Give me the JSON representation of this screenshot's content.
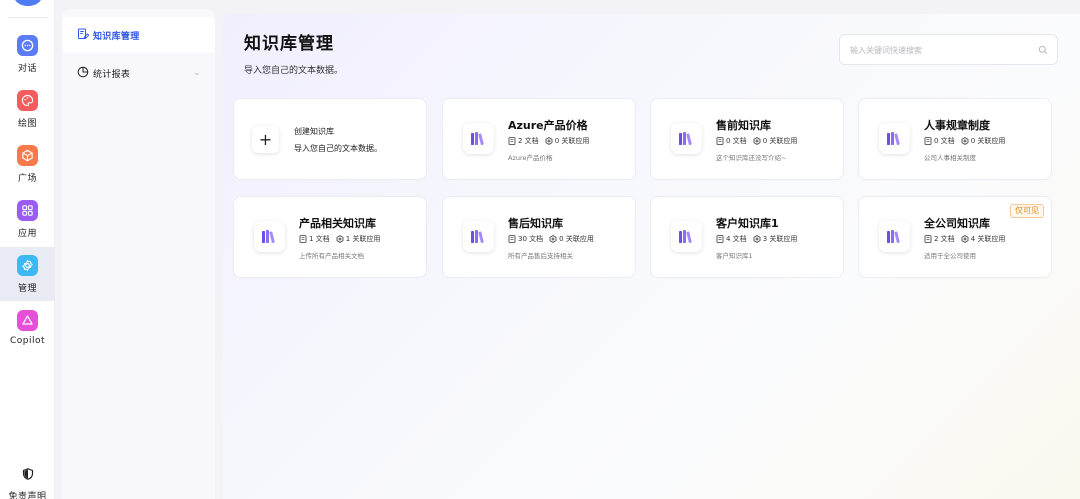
{
  "rail": {
    "items": [
      {
        "label": "对话",
        "icon": "chat-bubble-icon",
        "color": "#5b7cf6"
      },
      {
        "label": "绘图",
        "icon": "palette-icon",
        "color": "#f45d5d"
      },
      {
        "label": "广场",
        "icon": "cube-icon",
        "color": "#f87a4a"
      },
      {
        "label": "应用",
        "icon": "apps-grid-icon",
        "color": "#9a5cf3"
      },
      {
        "label": "管理",
        "icon": "gear-icon",
        "color": "#3cb8f2",
        "active": true
      },
      {
        "label": "Copilot",
        "icon": "copilot-triangle-icon",
        "color": "#e64fd8"
      }
    ],
    "disclaimer": {
      "label": "免责声明",
      "icon": "shield-icon"
    }
  },
  "submenu": {
    "items": [
      {
        "label": "知识库管理",
        "icon": "knowledge-edit-icon",
        "active": true
      },
      {
        "label": "统计报表",
        "icon": "pie-chart-icon",
        "expandable": true
      }
    ]
  },
  "main": {
    "title": "知识库管理",
    "subtitle": "导入您自己的文本数据。",
    "search_placeholder": "输入关键词快速搜索",
    "create_card": {
      "title": "创建知识库",
      "desc": "导入您自己的文本数据。"
    },
    "cards": [
      {
        "title": "Azure产品价格",
        "docs": "2 文档",
        "apps": "0 关联应用",
        "desc": "Azure产品价格"
      },
      {
        "title": "售前知识库",
        "docs": "0 文档",
        "apps": "0 关联应用",
        "desc": "这个知识库还没写介绍~"
      },
      {
        "title": "人事规章制度",
        "docs": "0 文档",
        "apps": "0 关联应用",
        "desc": "公司人事相关制度"
      },
      {
        "title": "产品相关知识库",
        "docs": "1 文档",
        "apps": "1 关联应用",
        "desc": "上传所有产品相关文档"
      },
      {
        "title": "售后知识库",
        "docs": "30 文档",
        "apps": "0 关联应用",
        "desc": "所有产品售后支持相关"
      },
      {
        "title": "客户知识库1",
        "docs": "4 文档",
        "apps": "3 关联应用",
        "desc": "客户知识库1"
      },
      {
        "title": "全公司知识库",
        "docs": "2 文档",
        "apps": "4 关联应用",
        "desc": "适用于全公司使用",
        "tag": "仅可见"
      }
    ]
  },
  "colors": {
    "accent": "#2f54eb",
    "book_purple": "#7b5cf2",
    "tag_orange": "#e08a2a"
  }
}
